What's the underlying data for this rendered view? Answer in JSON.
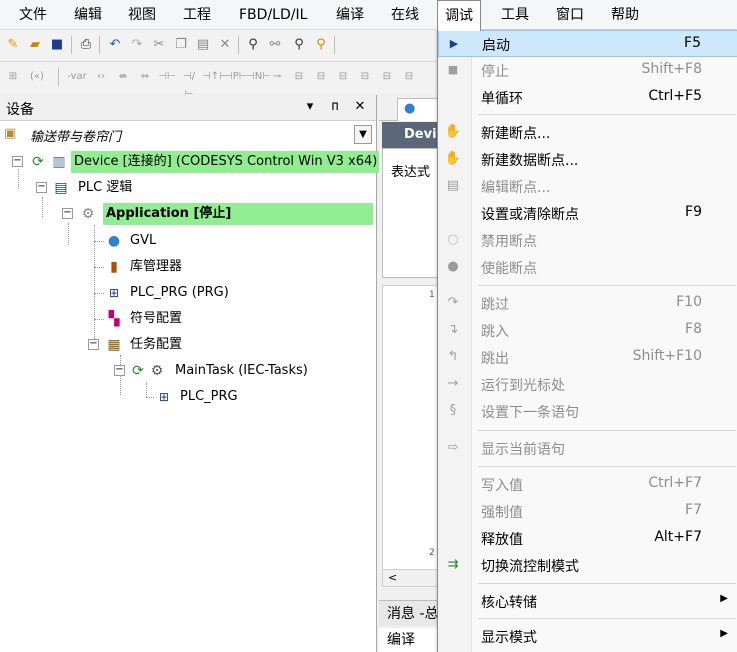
{
  "menubar": {
    "items": [
      {
        "label": "文件"
      },
      {
        "label": "编辑"
      },
      {
        "label": "视图"
      },
      {
        "label": "工程"
      },
      {
        "label": "FBD/LD/IL"
      },
      {
        "label": "编译"
      },
      {
        "label": "在线"
      },
      {
        "label": "调试"
      },
      {
        "label": "工具"
      },
      {
        "label": "窗口"
      },
      {
        "label": "帮助"
      }
    ]
  },
  "devices_panel": {
    "title": "设备",
    "pin_glyph": "▾",
    "dock_glyph": "ᴨ",
    "close_glyph": "✕",
    "breadcrumb": "输送带与卷帘门",
    "tree": {
      "device": "Device [连接的] (CODESYS Control Win V3 x64)",
      "plc_logic": "PLC 逻辑",
      "application": "Application [停止]",
      "gvl": "GVL",
      "library_manager": "库管理器",
      "plc_prg": "PLC_PRG (PRG)",
      "symbol_config": "符号配置",
      "task_config": "任务配置",
      "main_task": "MainTask (IEC-Tasks)",
      "main_task_prg": "PLC_PRG"
    }
  },
  "editor": {
    "header": "Devi",
    "expr_label": "表达式",
    "line_1": "1",
    "line_2": "2",
    "scroll_left": "<",
    "messages_tab": "消息 -总",
    "messages_row": "编译"
  },
  "debug_menu": {
    "items": [
      {
        "label": "启动",
        "shortcut": "F5",
        "icon": "play-icon"
      },
      {
        "label": "停止",
        "shortcut": "Shift+F8",
        "icon": "stop-icon"
      },
      {
        "label": "单循环",
        "shortcut": "Ctrl+F5",
        "icon": ""
      },
      {
        "label": "新建断点...",
        "shortcut": "",
        "icon": "new-breakpoint-icon"
      },
      {
        "label": "新建数据断点...",
        "shortcut": "",
        "icon": "new-data-breakpoint-icon"
      },
      {
        "label": "编辑断点...",
        "shortcut": "",
        "icon": "edit-breakpoint-icon"
      },
      {
        "label": "设置或清除断点",
        "shortcut": "F9",
        "icon": ""
      },
      {
        "label": "禁用断点",
        "shortcut": "",
        "icon": "disable-breakpoint-icon"
      },
      {
        "label": "使能断点",
        "shortcut": "",
        "icon": "enable-breakpoint-icon"
      },
      {
        "label": "跳过",
        "shortcut": "F10",
        "icon": "step-over-icon"
      },
      {
        "label": "跳入",
        "shortcut": "F8",
        "icon": "step-into-icon"
      },
      {
        "label": "跳出",
        "shortcut": "Shift+F10",
        "icon": "step-out-icon"
      },
      {
        "label": "运行到光标处",
        "shortcut": "",
        "icon": "run-to-cursor-icon"
      },
      {
        "label": "设置下一条语句",
        "shortcut": "",
        "icon": "set-next-statement-icon"
      },
      {
        "label": "显示当前语句",
        "shortcut": "",
        "icon": "show-current-statement-icon"
      },
      {
        "label": "写入值",
        "shortcut": "Ctrl+F7",
        "icon": ""
      },
      {
        "label": "强制值",
        "shortcut": "F7",
        "icon": ""
      },
      {
        "label": "释放值",
        "shortcut": "Alt+F7",
        "icon": ""
      },
      {
        "label": "切换流控制模式",
        "shortcut": "",
        "icon": "flow-control-icon"
      },
      {
        "label": "核心转储",
        "shortcut": "",
        "icon": ""
      },
      {
        "label": "显示模式",
        "shortcut": "",
        "icon": ""
      }
    ]
  },
  "colors": {
    "highlight_green": "#90ee90",
    "menu_selected": "#cde8fb",
    "disabled_text": "#8d8d8d"
  }
}
